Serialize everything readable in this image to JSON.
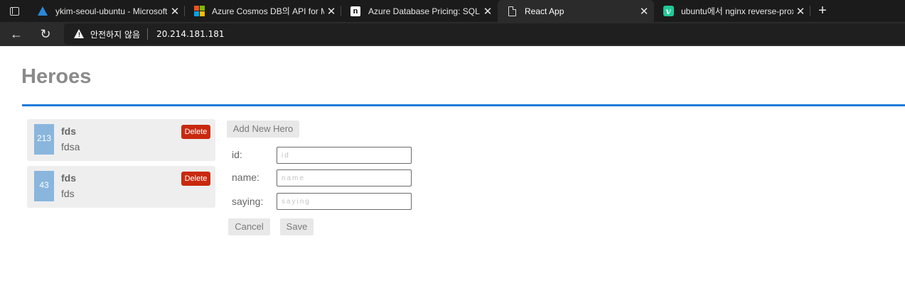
{
  "browser": {
    "tabs": [
      {
        "title": "ykim-seoul-ubuntu - Microsoft A",
        "favicon": "azure-icon"
      },
      {
        "title": "Azure Cosmos DB의 API for Mon",
        "favicon": "microsoft-icon"
      },
      {
        "title": "Azure Database Pricing: SQL Dat",
        "favicon": "notion-icon"
      },
      {
        "title": "React App",
        "favicon": "page-icon",
        "active": true
      },
      {
        "title": "ubuntu에서 nginx reverse-proxy",
        "favicon": "velog-icon"
      }
    ],
    "address_bar": {
      "security_text": "안전하지 않음",
      "url": "20.214.181.181"
    }
  },
  "page": {
    "title": "Heroes",
    "heroes": [
      {
        "id": "213",
        "name": "fds",
        "saying": "fdsa",
        "delete_label": "Delete"
      },
      {
        "id": "43",
        "name": "fds",
        "saying": "fds",
        "delete_label": "Delete"
      }
    ],
    "add_new_hero_label": "Add New Hero",
    "form": {
      "id_label": "id:",
      "id_placeholder": "id",
      "name_label": "name:",
      "name_placeholder": "name",
      "saying_label": "saying:",
      "saying_placeholder": "saying",
      "cancel_label": "Cancel",
      "save_label": "Save"
    }
  },
  "colors": {
    "accent": "#1e7bd9",
    "delete": "#c9290e",
    "hero_id_bg": "#8ab6dd"
  }
}
